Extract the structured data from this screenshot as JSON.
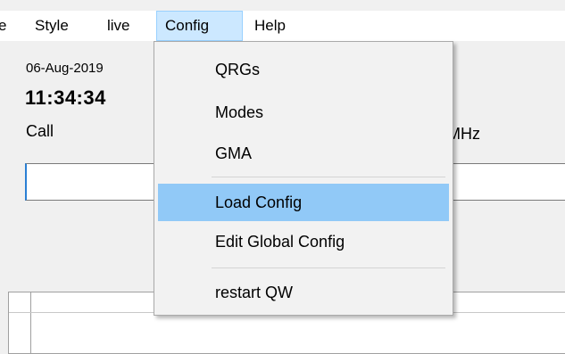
{
  "menubar": {
    "cut_off_label": "e",
    "items": [
      {
        "label": "Style"
      },
      {
        "label": "live"
      },
      {
        "label": "Config"
      },
      {
        "label": "Help"
      }
    ]
  },
  "status": {
    "date": "06-Aug-2019",
    "time": "11:34:34",
    "call_label": "Call",
    "mhz_label": "MHz"
  },
  "call_field": {
    "value": ""
  },
  "config_menu": {
    "items": [
      {
        "label": "QRGs"
      },
      {
        "label": "Modes"
      },
      {
        "label": "GMA"
      },
      {
        "label": "Load Config"
      },
      {
        "label": "Edit Global Config"
      },
      {
        "label": "restart QW"
      }
    ],
    "highlighted": "Load Config"
  },
  "colors": {
    "menubar_active_bg": "#cce8ff",
    "menu_highlight_bg": "#91c9f7",
    "input_focus_border": "#2a7fd4"
  }
}
